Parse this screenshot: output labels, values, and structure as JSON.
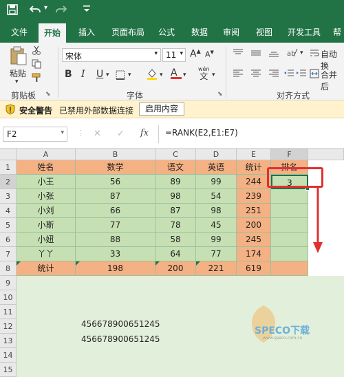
{
  "quick_access": {
    "save_icon": "save-icon",
    "undo_icon": "undo-icon",
    "redo_icon": "redo-icon",
    "customize_icon": "customize-icon"
  },
  "tabs": [
    "文件",
    "开始",
    "插入",
    "页面布局",
    "公式",
    "数据",
    "审阅",
    "视图",
    "开发工具",
    "帮"
  ],
  "active_tab": "开始",
  "ribbon": {
    "paste_label": "粘贴",
    "clipboard_label": "剪贴板",
    "font_name": "宋体",
    "font_size": "11",
    "bold": "B",
    "italic": "I",
    "underline": "U",
    "grow_font": "A",
    "shrink_font": "A",
    "font_color_btn": "A",
    "wen_label": "wén",
    "wen_char": "文",
    "font_group_label": "字体",
    "wrap_text": "自动换",
    "merge_center": "合并后",
    "align_group_label": "对齐方式"
  },
  "security_bar": {
    "title": "安全警告",
    "message": "已禁用外部数据连接",
    "button": "启用内容"
  },
  "formula_bar": {
    "name_box": "F2",
    "cancel": "✕",
    "enter": "✓",
    "fx": "fx",
    "formula": "=RANK(E2,E1:E7)"
  },
  "columns": [
    "A",
    "B",
    "C",
    "D",
    "E",
    "F"
  ],
  "row_numbers": [
    "1",
    "2",
    "3",
    "4",
    "5",
    "6",
    "7",
    "8",
    "9",
    "10",
    "11",
    "12",
    "13",
    "14",
    "15"
  ],
  "table": {
    "header": [
      "姓名",
      "数学",
      "语文",
      "英语",
      "统计",
      "排名"
    ],
    "rows": [
      [
        "小王",
        "56",
        "89",
        "99",
        "244",
        "3"
      ],
      [
        "小张",
        "87",
        "98",
        "54",
        "239",
        ""
      ],
      [
        "小刘",
        "66",
        "87",
        "98",
        "251",
        ""
      ],
      [
        "小斯",
        "77",
        "78",
        "45",
        "200",
        ""
      ],
      [
        "小妞",
        "88",
        "58",
        "99",
        "245",
        ""
      ],
      [
        "丫丫",
        "33",
        "64",
        "77",
        "174",
        ""
      ]
    ],
    "total": [
      "统计",
      "198",
      "200",
      "221",
      "619",
      ""
    ]
  },
  "extra_cells": {
    "row14_b": "456678900651245",
    "row15_b": "456678900651245"
  },
  "watermark": {
    "text": "SPECO下载",
    "sub": "www.speco.com.cn"
  },
  "colors": {
    "excel_green": "#217346",
    "header_orange": "#f4b183",
    "data_green": "#c6e0b4",
    "highlight_red": "#e03030"
  }
}
